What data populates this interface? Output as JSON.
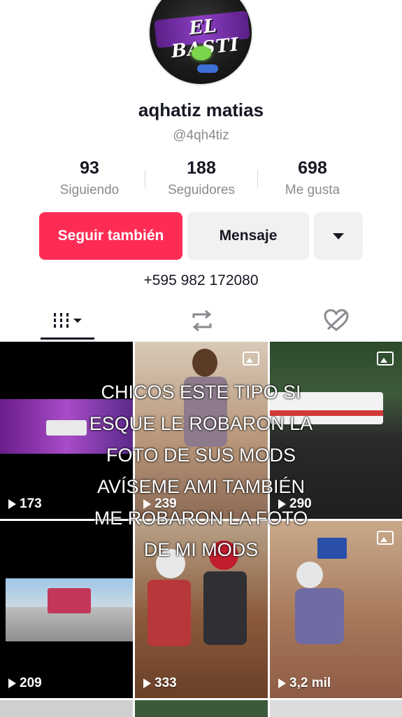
{
  "profile": {
    "name": "aqhatiz matias",
    "handle": "@4qh4tiz",
    "avatar_text": "EL BASTI",
    "bio_phone": "+595 982 172080"
  },
  "stats": [
    {
      "value": "93",
      "label": "Siguiendo"
    },
    {
      "value": "188",
      "label": "Seguidores"
    },
    {
      "value": "698",
      "label": "Me gusta"
    }
  ],
  "actions": {
    "follow_label": "Seguir también",
    "message_label": "Mensaje",
    "more_icon": "caret-down-icon"
  },
  "tabs": [
    {
      "icon": "grid-icon",
      "active": true
    },
    {
      "icon": "repost-icon",
      "active": false
    },
    {
      "icon": "liked-hidden-icon",
      "active": false
    }
  ],
  "videos": [
    {
      "views": "173"
    },
    {
      "views": "239"
    },
    {
      "views": "290"
    },
    {
      "views": "209"
    },
    {
      "views": "333"
    },
    {
      "views": "3,2 mil"
    }
  ],
  "overlay_caption": {
    "lines": [
      "CHICOS ESTE TIPO SI",
      "ESQUE LE ROBARON LA",
      "FOTO DE SUS MODS",
      "AVÍSEME AMI TAMBIÉN",
      "ME ROBARON LA FOTO",
      "DE MI MODS"
    ]
  },
  "colors": {
    "accent": "#fe2c55",
    "text": "#161823",
    "muted": "#8a8b91",
    "button_bg": "#f1f1f2"
  }
}
